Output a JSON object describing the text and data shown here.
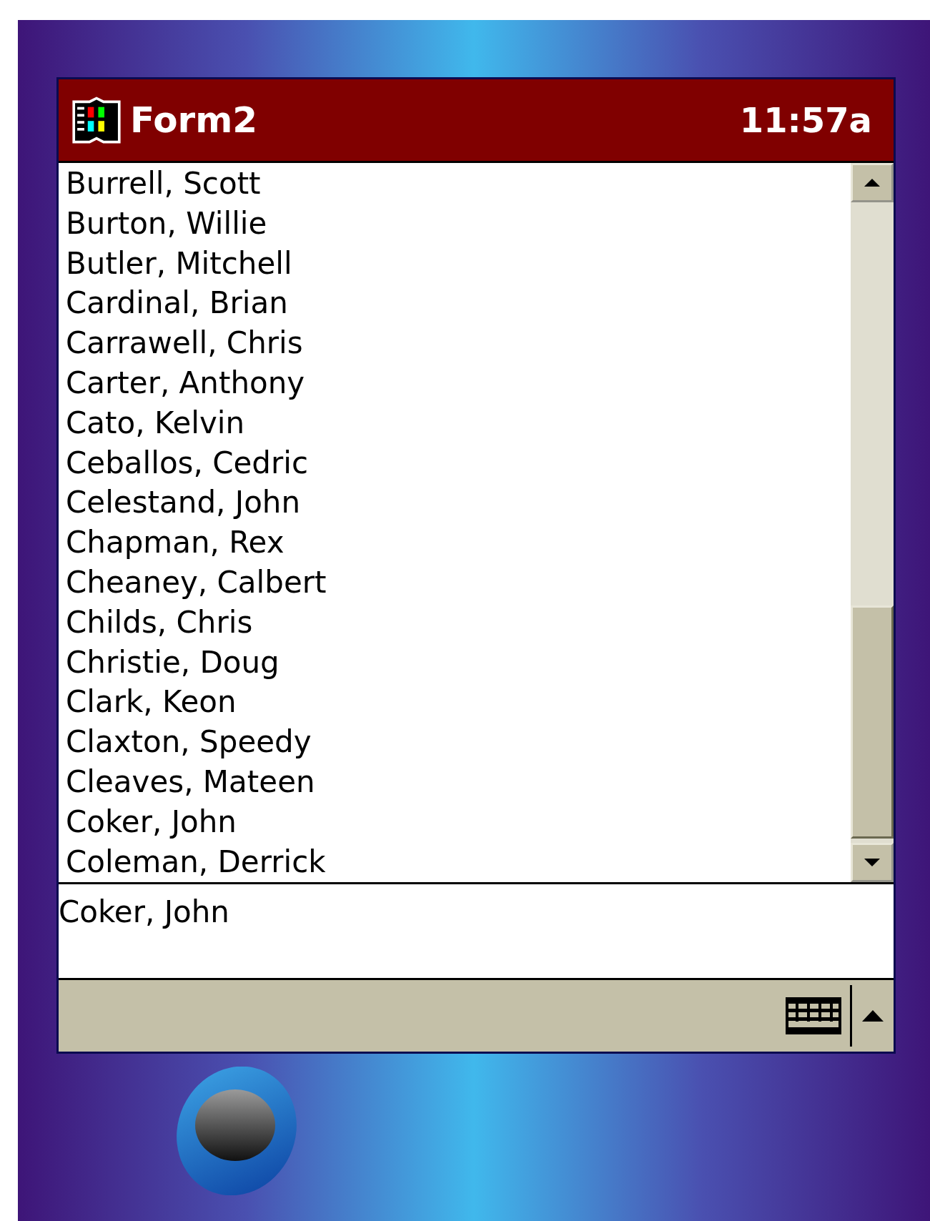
{
  "title_bar": {
    "title": "Form2",
    "time": "11:57a"
  },
  "list": {
    "items": [
      "Burrell, Scott",
      "Burton, Willie",
      "Butler, Mitchell",
      "Cardinal, Brian",
      "Carrawell, Chris",
      "Carter, Anthony",
      "Cato, Kelvin",
      "Ceballos, Cedric",
      "Celestand, John",
      "Chapman, Rex",
      "Cheaney, Calbert",
      "Childs, Chris",
      "Christie, Doug",
      "Clark, Keon",
      "Claxton, Speedy",
      "Cleaves, Mateen",
      "Coker, John",
      "Coleman, Derrick"
    ]
  },
  "text_box": {
    "value": "Coker, John"
  }
}
